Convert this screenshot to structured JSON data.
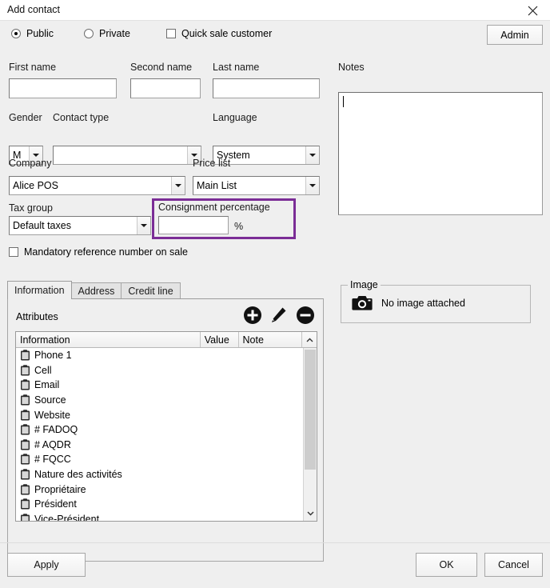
{
  "window": {
    "title": "Add contact",
    "close_icon": "close-icon"
  },
  "visibility": {
    "public_label": "Public",
    "private_label": "Private",
    "public_selected": true,
    "private_selected": false,
    "quick_sale_label": "Quick sale customer",
    "quick_sale_checked": false,
    "admin_label": "Admin"
  },
  "fields": {
    "first_name": {
      "label": "First name",
      "value": "",
      "placeholder": ""
    },
    "second_name": {
      "label": "Second name",
      "value": "",
      "placeholder": ""
    },
    "last_name": {
      "label": "Last name",
      "value": "",
      "placeholder": ""
    },
    "gender": {
      "label": "Gender",
      "value": "M"
    },
    "contact_type": {
      "label": "Contact type",
      "value": ""
    },
    "language": {
      "label": "Language",
      "value": "System"
    },
    "company": {
      "label": "Company",
      "value": "Alice POS"
    },
    "price_list": {
      "label": "Price list",
      "value": "Main List"
    },
    "tax_group": {
      "label": "Tax group",
      "value": "Default taxes"
    },
    "consignment_percentage": {
      "label": "Consignment percentage",
      "value": "",
      "suffix": "%",
      "highlight_color": "#7b2d96",
      "highlighted": true
    },
    "mandatory_reference": {
      "label": "Mandatory reference number on sale",
      "checked": false
    }
  },
  "notes": {
    "label": "Notes",
    "value": "",
    "placeholder": ""
  },
  "tabs": [
    {
      "label": "Information",
      "active": true
    },
    {
      "label": "Address",
      "active": false
    },
    {
      "label": "Credit line",
      "active": false
    }
  ],
  "attributes": {
    "section_label": "Attributes",
    "toolbar": [
      {
        "name": "add-attribute-button",
        "icon": "plus-circle-icon"
      },
      {
        "name": "edit-attribute-button",
        "icon": "pencil-icon"
      },
      {
        "name": "remove-attribute-button",
        "icon": "minus-circle-icon"
      }
    ],
    "columns": [
      "Information",
      "Value",
      "Note"
    ],
    "rows": [
      {
        "information": "Phone 1",
        "value": "",
        "note": ""
      },
      {
        "information": "Cell",
        "value": "",
        "note": ""
      },
      {
        "information": "Email",
        "value": "",
        "note": ""
      },
      {
        "information": "Source",
        "value": "",
        "note": ""
      },
      {
        "information": "Website",
        "value": "",
        "note": ""
      },
      {
        "information": "# FADOQ",
        "value": "",
        "note": ""
      },
      {
        "information": "# AQDR",
        "value": "",
        "note": ""
      },
      {
        "information": "# FQCC",
        "value": "",
        "note": ""
      },
      {
        "information": "Nature des activités",
        "value": "",
        "note": ""
      },
      {
        "information": "Propriétaire",
        "value": "",
        "note": ""
      },
      {
        "information": "Président",
        "value": "",
        "note": ""
      },
      {
        "information": "Vice-Président",
        "value": "",
        "note": ""
      }
    ],
    "scroll_up_icon": "chevron-up-icon",
    "scroll_down_icon": "chevron-down-icon"
  },
  "image": {
    "legend": "Image",
    "icon": "camera-icon",
    "status": "No image attached"
  },
  "footer": {
    "apply_label": "Apply",
    "ok_label": "OK",
    "cancel_label": "Cancel"
  }
}
